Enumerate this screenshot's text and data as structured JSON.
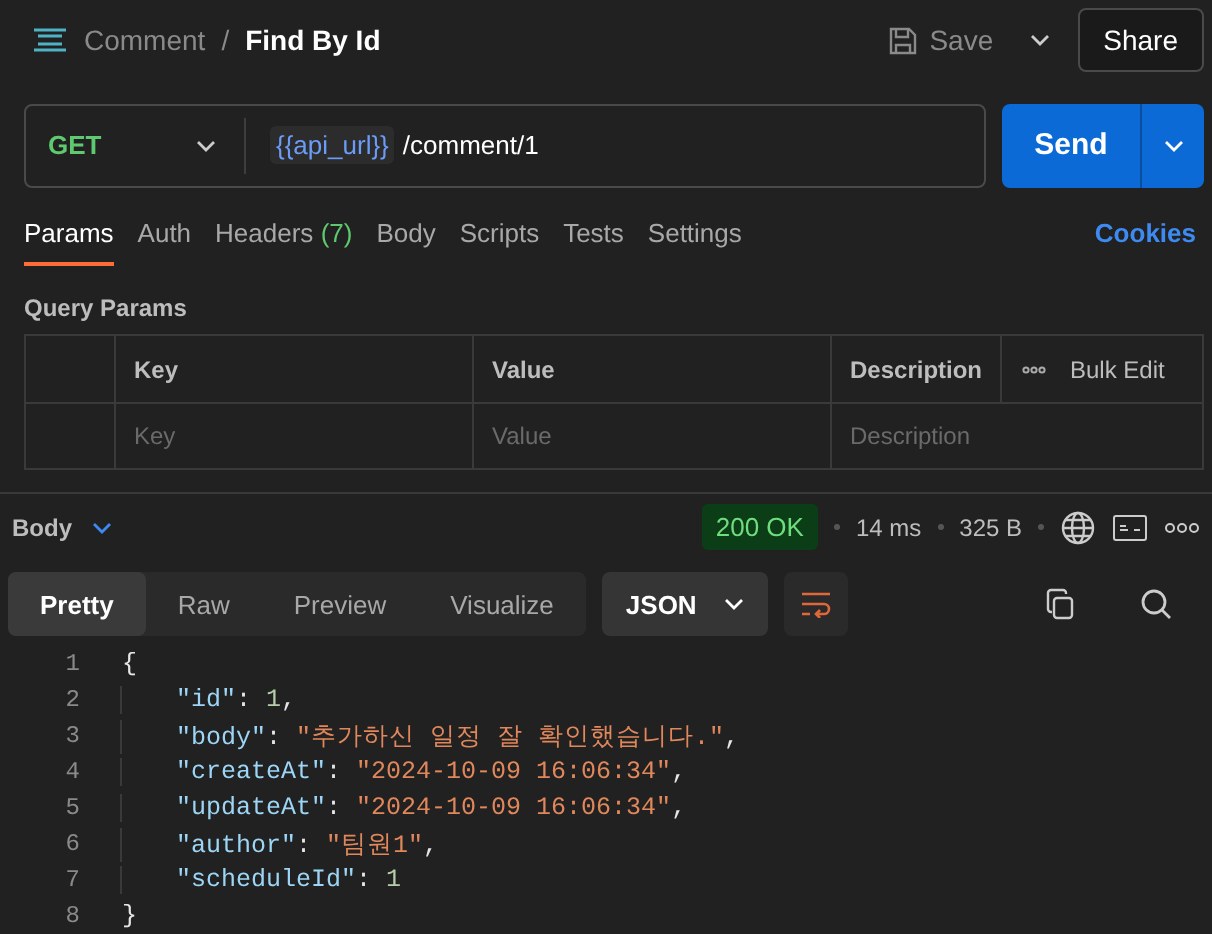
{
  "header": {
    "breadcrumb_parent": "Comment",
    "separator": "/",
    "title": "Find By Id",
    "save_label": "Save",
    "share_label": "Share"
  },
  "request": {
    "method": "GET",
    "url_variable": "{{api_url}}",
    "url_path": "/comment/1",
    "send_label": "Send"
  },
  "request_tabs": [
    {
      "label": "Params",
      "selected": true
    },
    {
      "label": "Auth",
      "selected": false
    },
    {
      "label": "Headers",
      "count": "(7)",
      "selected": false
    },
    {
      "label": "Body",
      "selected": false
    },
    {
      "label": "Scripts",
      "selected": false
    },
    {
      "label": "Tests",
      "selected": false
    },
    {
      "label": "Settings",
      "selected": false
    }
  ],
  "cookies_link": "Cookies",
  "query_params": {
    "title": "Query Params",
    "columns": [
      "Key",
      "Value",
      "Description"
    ],
    "bulk_edit": "Bulk Edit",
    "placeholders": [
      "Key",
      "Value",
      "Description"
    ]
  },
  "response": {
    "section": "Body",
    "status": "200 OK",
    "time": "14 ms",
    "size": "325 B"
  },
  "view_tabs": [
    {
      "label": "Pretty",
      "selected": true
    },
    {
      "label": "Raw",
      "selected": false
    },
    {
      "label": "Preview",
      "selected": false
    },
    {
      "label": "Visualize",
      "selected": false
    }
  ],
  "format": "JSON",
  "code_lines": [
    {
      "number": "1",
      "indented": false,
      "tokens": [
        {
          "kind": "punct",
          "text": "{"
        }
      ]
    },
    {
      "number": "2",
      "indented": true,
      "tokens": [
        {
          "kind": "key",
          "text": "\"id\""
        },
        {
          "kind": "punct",
          "text": ": "
        },
        {
          "kind": "number",
          "text": "1"
        },
        {
          "kind": "punct",
          "text": ","
        }
      ]
    },
    {
      "number": "3",
      "indented": true,
      "tokens": [
        {
          "kind": "key",
          "text": "\"body\""
        },
        {
          "kind": "punct",
          "text": ": "
        },
        {
          "kind": "string",
          "text": "\"추가하신 일정 잘 확인했습니다.\""
        },
        {
          "kind": "punct",
          "text": ","
        }
      ]
    },
    {
      "number": "4",
      "indented": true,
      "tokens": [
        {
          "kind": "key",
          "text": "\"createAt\""
        },
        {
          "kind": "punct",
          "text": ": "
        },
        {
          "kind": "string",
          "text": "\"2024-10-09 16:06:34\""
        },
        {
          "kind": "punct",
          "text": ","
        }
      ]
    },
    {
      "number": "5",
      "indented": true,
      "tokens": [
        {
          "kind": "key",
          "text": "\"updateAt\""
        },
        {
          "kind": "punct",
          "text": ": "
        },
        {
          "kind": "string",
          "text": "\"2024-10-09 16:06:34\""
        },
        {
          "kind": "punct",
          "text": ","
        }
      ]
    },
    {
      "number": "6",
      "indented": true,
      "tokens": [
        {
          "kind": "key",
          "text": "\"author\""
        },
        {
          "kind": "punct",
          "text": ": "
        },
        {
          "kind": "string",
          "text": "\"팀원1\""
        },
        {
          "kind": "punct",
          "text": ","
        }
      ]
    },
    {
      "number": "7",
      "indented": true,
      "tokens": [
        {
          "kind": "key",
          "text": "\"scheduleId\""
        },
        {
          "kind": "punct",
          "text": ": "
        },
        {
          "kind": "number",
          "text": "1"
        }
      ]
    },
    {
      "number": "8",
      "indented": false,
      "tokens": [
        {
          "kind": "punct",
          "text": "}"
        }
      ]
    }
  ]
}
